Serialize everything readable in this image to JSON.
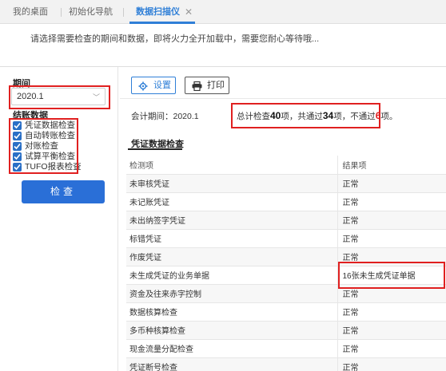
{
  "tabs": [
    {
      "label": "我的桌面"
    },
    {
      "label": "初始化导航"
    },
    {
      "label": "数据扫描仪"
    }
  ],
  "notice": "请选择需要检查的期间和数据，即将火力全开加载中，需要您耐心等待哦...",
  "left": {
    "period_label": "期间",
    "period_value": "2020.1",
    "closing_label": "结账数据",
    "checkboxes": [
      "凭证数据检查",
      "自动转账检查",
      "对账检查",
      "试算平衡检查",
      "TUFO报表检查"
    ],
    "check_button": "检查"
  },
  "toolbar": {
    "settings_label": "设置",
    "print_label": "打印"
  },
  "summary": {
    "period_text": "会计期间：2020.1",
    "prefix": "总计检查",
    "total": "40",
    "mid1": "项，共通过",
    "passed": "34",
    "mid2": "项，不通过",
    "failed": "6",
    "suffix": "项。"
  },
  "section": {
    "title": "凭证数据检查",
    "columns": [
      "检测项",
      "结果项"
    ],
    "rows": [
      {
        "item": "未审核凭证",
        "result": "正常"
      },
      {
        "item": "未记账凭证",
        "result": "正常"
      },
      {
        "item": "未出纳签字凭证",
        "result": "正常"
      },
      {
        "item": "标错凭证",
        "result": "正常"
      },
      {
        "item": "作废凭证",
        "result": "正常"
      },
      {
        "item": "未生成凭证的业务单据",
        "result": "16张未生成凭证单据"
      },
      {
        "item": "资金及往来赤字控制",
        "result": "正常"
      },
      {
        "item": "数据核算检查",
        "result": "正常"
      },
      {
        "item": "多币种核算检查",
        "result": "正常"
      },
      {
        "item": "现金流量分配检查",
        "result": "正常"
      },
      {
        "item": "凭证断号检查",
        "result": "正常"
      }
    ]
  },
  "colors": {
    "accent": "#2f7fd7",
    "button": "#2a6fd7",
    "highlight_box": "#e02020",
    "checkbox": "#2a6fc6"
  }
}
